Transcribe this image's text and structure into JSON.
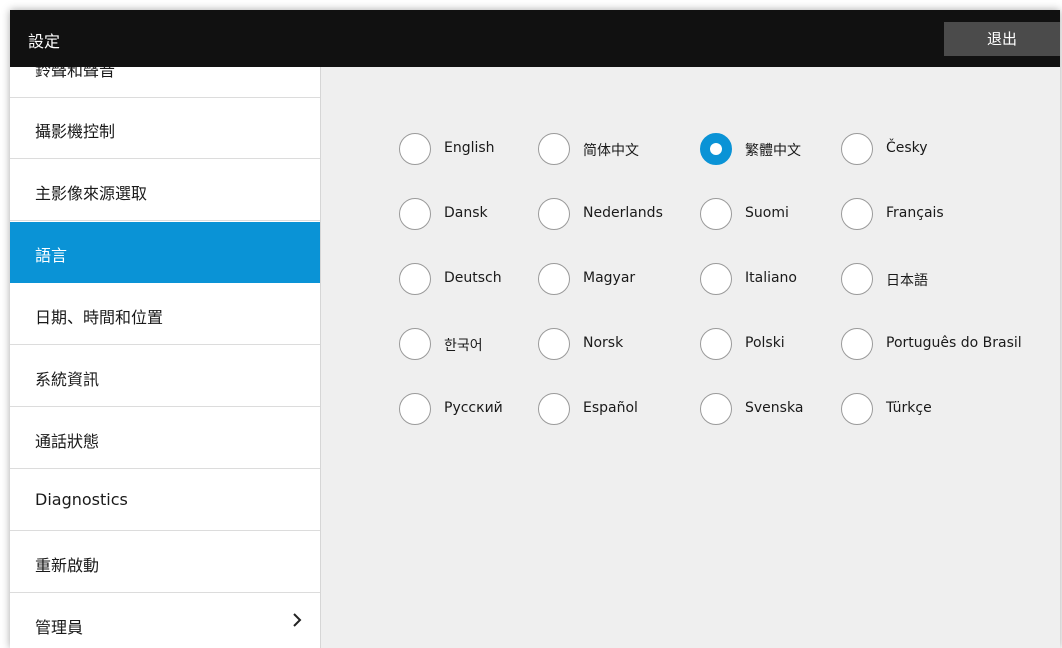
{
  "header": {
    "title": "設定",
    "exit_label": "退出"
  },
  "sidebar": {
    "items": [
      {
        "label": "鈴聲和聲音"
      },
      {
        "label": "攝影機控制"
      },
      {
        "label": "主影像來源選取"
      },
      {
        "label": "語言"
      },
      {
        "label": "日期、時間和位置"
      },
      {
        "label": "系統資訊"
      },
      {
        "label": "通話狀態"
      },
      {
        "label": "Diagnostics"
      },
      {
        "label": "重新啟動"
      },
      {
        "label": "管理員"
      }
    ],
    "active_item": "語言"
  },
  "languages": {
    "selected": "繁體中文",
    "options": [
      "English",
      "简体中文",
      "繁體中文",
      "Česky",
      "Dansk",
      "Nederlands",
      "Suomi",
      "Français",
      "Deutsch",
      "Magyar",
      "Italiano",
      "日本語",
      "한국어",
      "Norsk",
      "Polski",
      "Português do Brasil",
      "Русский",
      "Español",
      "Svenska",
      "Türkçe"
    ]
  },
  "colors": {
    "accent": "#0a93d6",
    "topbar": "#111111",
    "background": "#efefef"
  },
  "icons": {
    "admin_item": "chevron-right-icon"
  }
}
